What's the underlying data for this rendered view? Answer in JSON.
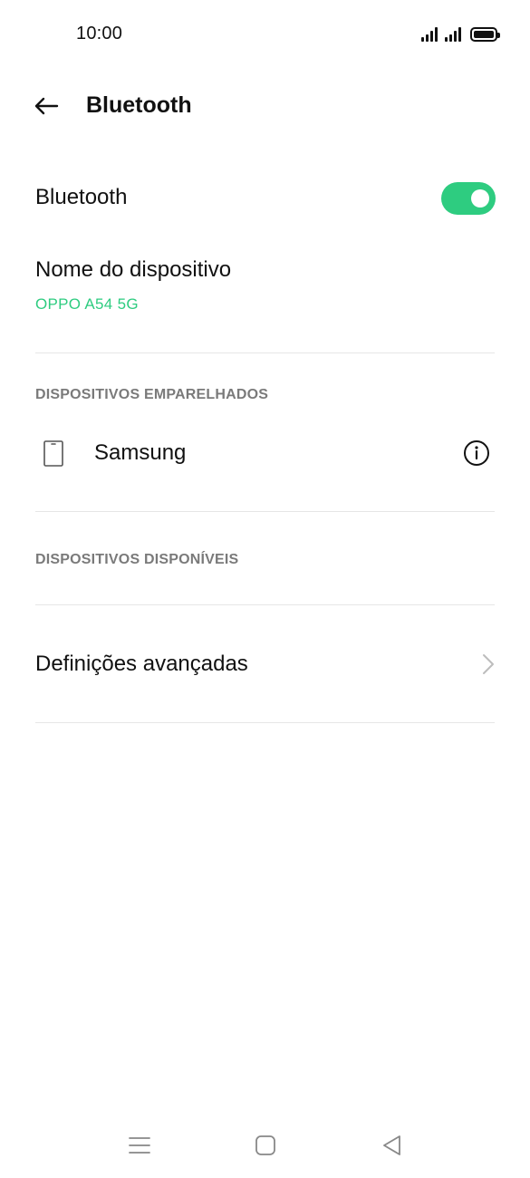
{
  "status_bar": {
    "time": "10:00",
    "icons": [
      "signal-icon",
      "signal-icon",
      "battery-icon"
    ]
  },
  "header": {
    "back_icon": "arrow-left-icon",
    "title": "Bluetooth"
  },
  "bluetooth_toggle": {
    "label": "Bluetooth",
    "state": "on",
    "color": "#2ecc80"
  },
  "device_name": {
    "label": "Nome do dispositivo",
    "value": "OPPO A54 5G"
  },
  "paired_section": {
    "header": "DISPOSITIVOS EMPARELHADOS",
    "devices": [
      {
        "name": "Samsung",
        "icon": "phone-icon",
        "action_icon": "info-icon"
      }
    ]
  },
  "available_section": {
    "header": "DISPOSITIVOS DISPONÍVEIS"
  },
  "advanced": {
    "label": "Definições avançadas",
    "icon": "chevron-right-icon"
  },
  "nav_bar": {
    "icons": [
      "menu-icon",
      "home-icon",
      "back-icon"
    ]
  },
  "colors": {
    "accent": "#2ecc80",
    "section_text": "#7a7a7a",
    "divider": "#e6e6e6"
  }
}
